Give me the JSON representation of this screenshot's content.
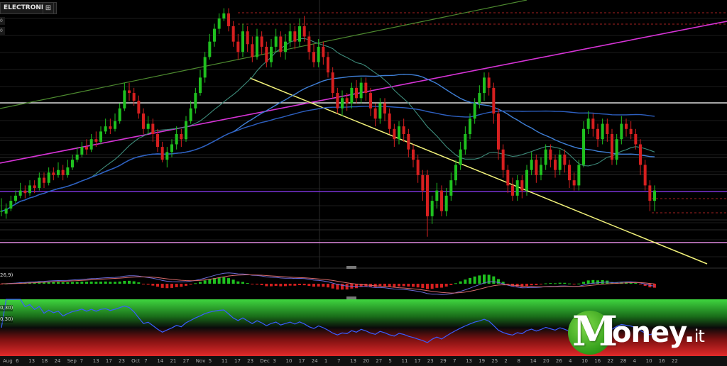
{
  "header": {
    "ticker": "ELECTRONICS",
    "button_glyph": "⊞",
    "side_tags": [
      "0",
      "0"
    ],
    "macd_label": "26,9)",
    "rsi_labels": [
      "0,30)",
      "0,30)"
    ]
  },
  "logo": {
    "letter_m": "M",
    "rest": "oney",
    "dot": ".",
    "suffix": "it"
  },
  "colors": {
    "up": "#1fc11f",
    "down": "#d61f1f",
    "ma_fast": "#3d8a7a",
    "ma_mid": "#3f7fd6",
    "ma_slow": "#2d5fc0",
    "trend_yellow": "#f2f27a",
    "trend_magenta": "#d633d6",
    "trend_green": "#4d8a2f",
    "level_white": "#ffffff",
    "level_purple": "#7a33d6",
    "level_pink": "#e08ae0",
    "dashed_red": "#a31f1f",
    "logo_green": "#3aa51f"
  },
  "chart_data": {
    "type": "candlestick",
    "title": "",
    "xlabel": "",
    "ylabel": "",
    "x_tick_labels": [
      "Aug",
      "6",
      "13",
      "18",
      "24",
      "Sep",
      "7",
      "13",
      "17",
      "23",
      "Oct",
      "7",
      "14",
      "21",
      "27",
      "Nov",
      "5",
      "11",
      "17",
      "23",
      "Dec",
      "3",
      "10",
      "17",
      "24",
      "1",
      "7",
      "13",
      "20",
      "27",
      "5",
      "11",
      "17",
      "23",
      "29",
      "7",
      "13",
      "19",
      "25",
      "2",
      "8",
      "14",
      "20",
      "26",
      "4",
      "10",
      "16",
      "22",
      "28",
      "4",
      "10",
      "16",
      "22"
    ],
    "ylim": [
      0,
      100
    ],
    "candles": [
      [
        20,
        20,
        25,
        18
      ],
      [
        19,
        21,
        23,
        17
      ],
      [
        21,
        24,
        26,
        20
      ],
      [
        24,
        26,
        28,
        23
      ],
      [
        26,
        28,
        31,
        25
      ],
      [
        28,
        27,
        30,
        25
      ],
      [
        27,
        30,
        32,
        26
      ],
      [
        30,
        29,
        32,
        27
      ],
      [
        29,
        33,
        35,
        28
      ],
      [
        33,
        31,
        35,
        29
      ],
      [
        31,
        35,
        37,
        30
      ],
      [
        35,
        34,
        37,
        32
      ],
      [
        34,
        36,
        39,
        33
      ],
      [
        36,
        34,
        38,
        32
      ],
      [
        34,
        37,
        40,
        33
      ],
      [
        37,
        40,
        42,
        36
      ],
      [
        40,
        42,
        45,
        39
      ],
      [
        42,
        45,
        47,
        41
      ],
      [
        45,
        44,
        48,
        42
      ],
      [
        44,
        48,
        50,
        43
      ],
      [
        48,
        47,
        51,
        45
      ],
      [
        47,
        51,
        53,
        46
      ],
      [
        51,
        53,
        56,
        50
      ],
      [
        53,
        52,
        56,
        50
      ],
      [
        52,
        55,
        58,
        51
      ],
      [
        55,
        60,
        62,
        54
      ],
      [
        60,
        67,
        70,
        59
      ],
      [
        67,
        66,
        70,
        63
      ],
      [
        66,
        63,
        68,
        61
      ],
      [
        63,
        58,
        65,
        56
      ],
      [
        58,
        52,
        60,
        50
      ],
      [
        52,
        54,
        57,
        50
      ],
      [
        54,
        50,
        56,
        47
      ],
      [
        50,
        45,
        52,
        43
      ],
      [
        45,
        40,
        47,
        39
      ],
      [
        40,
        43,
        45,
        37
      ],
      [
        43,
        46,
        48,
        41
      ],
      [
        46,
        50,
        53,
        44
      ],
      [
        50,
        48,
        52,
        45
      ],
      [
        48,
        55,
        57,
        47
      ],
      [
        55,
        60,
        63,
        54
      ],
      [
        60,
        66,
        68,
        58
      ],
      [
        66,
        72,
        75,
        65
      ],
      [
        72,
        80,
        82,
        70
      ],
      [
        80,
        86,
        89,
        79
      ],
      [
        86,
        91,
        93,
        84
      ],
      [
        91,
        95,
        97,
        89
      ],
      [
        95,
        97,
        99,
        94
      ],
      [
        97,
        92,
        99,
        90
      ],
      [
        92,
        86,
        94,
        84
      ],
      [
        86,
        82,
        89,
        79
      ],
      [
        82,
        90,
        93,
        80
      ],
      [
        90,
        85,
        92,
        82
      ],
      [
        85,
        80,
        88,
        78
      ],
      [
        80,
        88,
        91,
        79
      ],
      [
        88,
        84,
        90,
        81
      ],
      [
        84,
        78,
        86,
        76
      ],
      [
        78,
        84,
        87,
        76
      ],
      [
        84,
        88,
        91,
        82
      ],
      [
        88,
        82,
        90,
        80
      ],
      [
        82,
        86,
        89,
        79
      ],
      [
        86,
        90,
        93,
        84
      ],
      [
        90,
        86,
        92,
        83
      ],
      [
        86,
        92,
        95,
        84
      ],
      [
        92,
        88,
        96,
        86
      ],
      [
        88,
        82,
        90,
        79
      ],
      [
        82,
        78,
        85,
        76
      ],
      [
        78,
        84,
        87,
        76
      ],
      [
        84,
        80,
        86,
        77
      ],
      [
        80,
        74,
        82,
        72
      ],
      [
        74,
        66,
        76,
        64
      ],
      [
        66,
        60,
        68,
        58
      ],
      [
        60,
        64,
        67,
        57
      ],
      [
        64,
        62,
        66,
        59
      ],
      [
        62,
        68,
        70,
        60
      ],
      [
        68,
        64,
        71,
        62
      ],
      [
        64,
        70,
        72,
        62
      ],
      [
        70,
        66,
        72,
        63
      ],
      [
        66,
        60,
        68,
        57
      ],
      [
        60,
        56,
        62,
        53
      ],
      [
        56,
        62,
        64,
        54
      ],
      [
        62,
        58,
        64,
        55
      ],
      [
        58,
        52,
        60,
        50
      ],
      [
        52,
        48,
        54,
        45
      ],
      [
        48,
        53,
        55,
        46
      ],
      [
        53,
        50,
        56,
        47
      ],
      [
        50,
        44,
        52,
        41
      ],
      [
        44,
        40,
        46,
        37
      ],
      [
        40,
        34,
        42,
        31
      ],
      [
        34,
        28,
        36,
        24
      ],
      [
        34,
        18,
        36,
        10
      ],
      [
        18,
        24,
        26,
        15
      ],
      [
        24,
        28,
        31,
        21
      ],
      [
        28,
        20,
        30,
        18
      ],
      [
        20,
        26,
        29,
        18
      ],
      [
        26,
        32,
        35,
        24
      ],
      [
        32,
        38,
        40,
        30
      ],
      [
        38,
        44,
        47,
        36
      ],
      [
        44,
        50,
        53,
        42
      ],
      [
        50,
        56,
        58,
        48
      ],
      [
        56,
        62,
        64,
        54
      ],
      [
        62,
        66,
        69,
        60
      ],
      [
        66,
        72,
        74,
        63
      ],
      [
        72,
        68,
        74,
        65
      ],
      [
        68,
        58,
        70,
        54
      ],
      [
        58,
        44,
        60,
        40
      ],
      [
        44,
        36,
        46,
        33
      ],
      [
        36,
        30,
        38,
        27
      ],
      [
        30,
        26,
        33,
        24
      ],
      [
        26,
        32,
        34,
        24
      ],
      [
        32,
        28,
        34,
        25
      ],
      [
        28,
        36,
        38,
        26
      ],
      [
        36,
        40,
        43,
        34
      ],
      [
        40,
        34,
        42,
        31
      ],
      [
        34,
        38,
        41,
        32
      ],
      [
        38,
        44,
        46,
        36
      ],
      [
        44,
        40,
        46,
        37
      ],
      [
        40,
        36,
        42,
        33
      ],
      [
        36,
        42,
        44,
        34
      ],
      [
        42,
        38,
        44,
        35
      ],
      [
        38,
        32,
        40,
        29
      ],
      [
        32,
        30,
        35,
        28
      ],
      [
        30,
        38,
        40,
        28
      ],
      [
        38,
        52,
        55,
        37
      ],
      [
        52,
        56,
        59,
        50
      ],
      [
        56,
        52,
        58,
        49
      ],
      [
        52,
        48,
        54,
        45
      ],
      [
        48,
        54,
        56,
        46
      ],
      [
        54,
        50,
        56,
        47
      ],
      [
        50,
        40,
        52,
        38
      ],
      [
        40,
        48,
        50,
        38
      ],
      [
        48,
        54,
        57,
        46
      ],
      [
        54,
        52,
        56,
        49
      ],
      [
        52,
        50,
        55,
        48
      ],
      [
        50,
        46,
        52,
        44
      ],
      [
        46,
        38,
        48,
        34
      ],
      [
        38,
        30,
        40,
        28
      ],
      [
        30,
        24,
        32,
        20
      ],
      [
        24,
        28,
        30,
        20
      ]
    ]
  }
}
